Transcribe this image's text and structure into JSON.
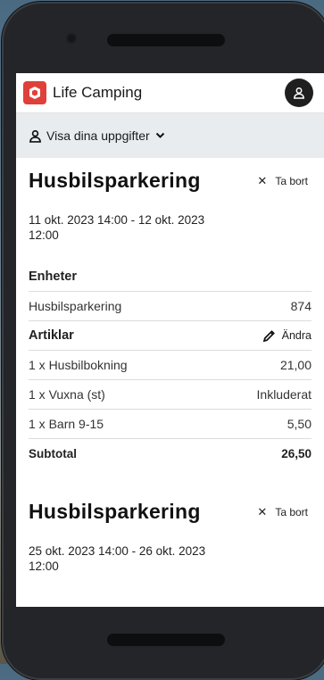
{
  "app": {
    "title": "Life Camping",
    "account_label": "Visa dina uppgifter"
  },
  "bookings": [
    {
      "title": "Husbilsparkering",
      "remove_label": "Ta bort",
      "dates": "11 okt. 2023 14:00 - 12 okt. 2023 12:00",
      "units_heading": "Enheter",
      "units": [
        {
          "name": "Husbilsparkering",
          "value": "874"
        }
      ],
      "articles_heading": "Artiklar",
      "edit_label": "Ändra",
      "articles": [
        {
          "name": "1 x Husbilbokning",
          "value": "21,00"
        },
        {
          "name": "1 x Vuxna (st)",
          "value": "Inkluderat"
        },
        {
          "name": "1 x Barn 9-15",
          "value": "5,50"
        }
      ],
      "subtotal_label": "Subtotal",
      "subtotal_value": "26,50"
    },
    {
      "title": "Husbilsparkering",
      "remove_label": "Ta bort",
      "dates": "25 okt. 2023 14:00 - 26 okt. 2023 12:00"
    }
  ],
  "icons": {
    "logo": "life-camping-logo-icon",
    "user": "user-icon",
    "account": "person-icon",
    "chevron": "chevron-down-icon",
    "close": "close-icon",
    "edit": "pencil-icon"
  },
  "colors": {
    "brand": "#e0403a",
    "subbar_bg": "#e8ecef",
    "user_btn": "#1f1f1f"
  }
}
